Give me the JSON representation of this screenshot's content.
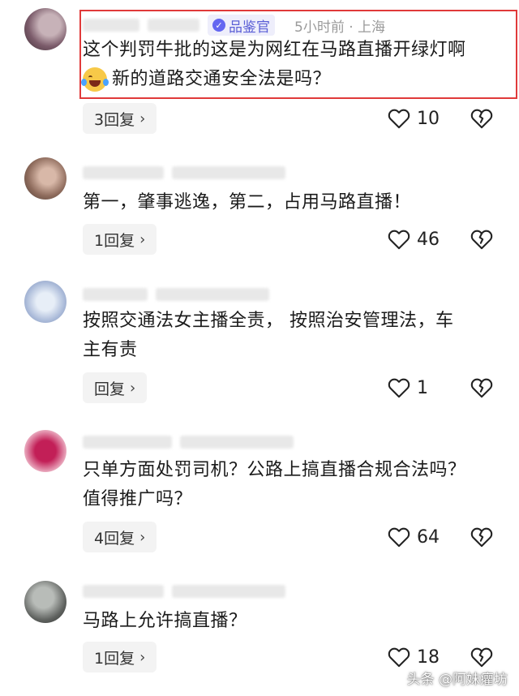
{
  "comments": [
    {
      "avatar_colors": [
        "#7b5b6a",
        "#c7b2b8"
      ],
      "badge": "品鉴官",
      "time_location": "5小时前 · 上海",
      "text_line1": "这个判罚牛批的这是为网红在马路直播开绿灯啊",
      "text_line2": "新的道路交通安全法是吗？",
      "emoji": "crying-laughing-emoji",
      "replies": "3回复",
      "likes": "10"
    },
    {
      "avatar_colors": [
        "#8e6b5c",
        "#d8b8a8"
      ],
      "text_line1": "第一，肇事逃逸，第二，占用马路直播！",
      "replies": "1回复",
      "likes": "46"
    },
    {
      "avatar_colors": [
        "#a9b9d8",
        "#e7eef7"
      ],
      "text_line1": "按照交通法女主播全责， 按照治安管理法，车",
      "text_line2": "主有责",
      "replies": "回复",
      "likes": "1"
    },
    {
      "avatar_colors": [
        "#c21f57",
        "#e9a8bd"
      ],
      "text_line1": "只单方面处罚司机？公路上搞直播合规合法吗？",
      "text_line2": "值得推广吗？",
      "replies": "4回复",
      "likes": "64"
    },
    {
      "avatar_colors": [
        "#5f625f",
        "#b8bcb8"
      ],
      "text_line1": "马路上允许搞直播？",
      "replies": "1回复",
      "likes": "18"
    }
  ],
  "icons": {
    "like": "heart-outline-icon",
    "dislike": "broken-heart-icon",
    "chevron": "chevron-right-icon"
  },
  "watermark": "头条 @阿妹癯坊",
  "colors": {
    "highlight": "#e03a3a",
    "badge": "#5b5fd6"
  }
}
